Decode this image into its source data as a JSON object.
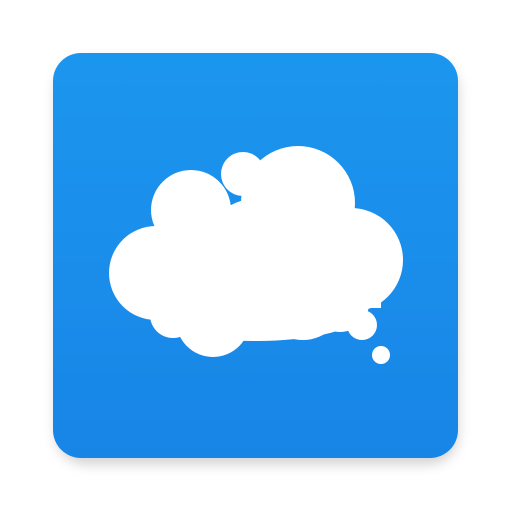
{
  "app": {
    "icon": "thought-bubble-icon",
    "colors": {
      "background_top": "#1b96ee",
      "background_bottom": "#1785e6",
      "cloud": "#ffffff",
      "page": "#ffffff"
    }
  }
}
